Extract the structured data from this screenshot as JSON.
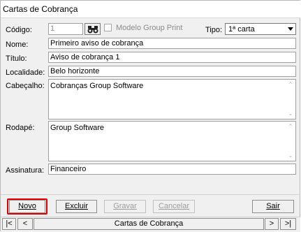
{
  "window": {
    "title": "Cartas de Cobrança"
  },
  "form": {
    "codigo": {
      "label": "Código:",
      "value": "1"
    },
    "modelo_group_print": {
      "label": "Modelo Group Print",
      "checked": false
    },
    "tipo": {
      "label": "Tipo:",
      "value": "1ª carta"
    },
    "nome": {
      "label": "Nome:",
      "value": "Primeiro aviso de cobrança"
    },
    "titulo": {
      "label": "Título:",
      "value": "Aviso de cobrança 1"
    },
    "localidade": {
      "label": "Localidade:",
      "value": "Belo horizonte"
    },
    "cabecalho": {
      "label": "Cabeçalho:",
      "value": "Cobranças Group Software"
    },
    "rodape": {
      "label": "Rodapé:",
      "value": "Group Software"
    },
    "assinatura": {
      "label": "Assinatura:",
      "value": "Financeiro"
    }
  },
  "buttons": {
    "novo": {
      "label": "Novo",
      "enabled": true
    },
    "excluir": {
      "label": "Excluir",
      "enabled": true
    },
    "gravar": {
      "label": "Gravar",
      "enabled": false
    },
    "cancelar": {
      "label": "Cancelar",
      "enabled": false
    },
    "sair": {
      "label": "Sair",
      "enabled": true
    }
  },
  "navigator": {
    "first": "|<",
    "prev": "<",
    "caption": "Cartas de Cobrança",
    "next": ">",
    "last": ">|"
  },
  "colors": {
    "highlight": "#e00000",
    "window_bg": "#f0f0f0"
  },
  "icons": {
    "search": "binoculars-icon",
    "dropdown": "chevron-down-icon",
    "scroll_up": "scroll-up-icon",
    "scroll_down": "scroll-down-icon"
  }
}
